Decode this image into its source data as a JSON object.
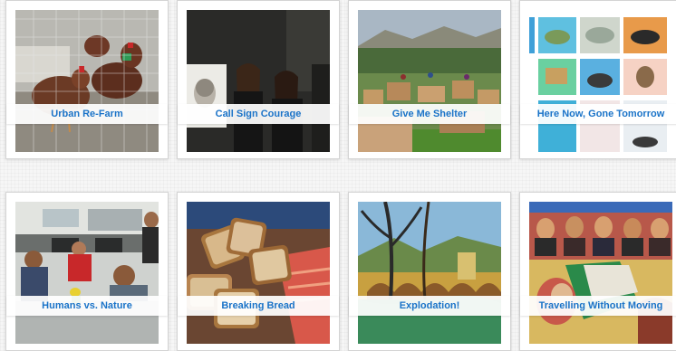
{
  "gallery": {
    "items": [
      {
        "caption": "Urban Re-Farm",
        "image": "chickens-in-coop"
      },
      {
        "caption": "Call Sign Courage",
        "image": "students-with-portrait"
      },
      {
        "caption": "Give Me Shelter",
        "image": "cardboard-shelter-field"
      },
      {
        "caption": "Here Now, Gone Tomorrow",
        "image": "animal-paintings-grid"
      },
      {
        "caption": "Humans vs. Nature",
        "image": "students-in-classroom"
      },
      {
        "caption": "Breaking Bread",
        "image": "bread-slices"
      },
      {
        "caption": "Explodation!",
        "image": "bridge-painting"
      },
      {
        "caption": "Travelling Without Moving",
        "image": "mural-portraits"
      }
    ]
  },
  "colors": {
    "caption_text": "#1a73c8",
    "card_border": "#d4d4d4"
  }
}
